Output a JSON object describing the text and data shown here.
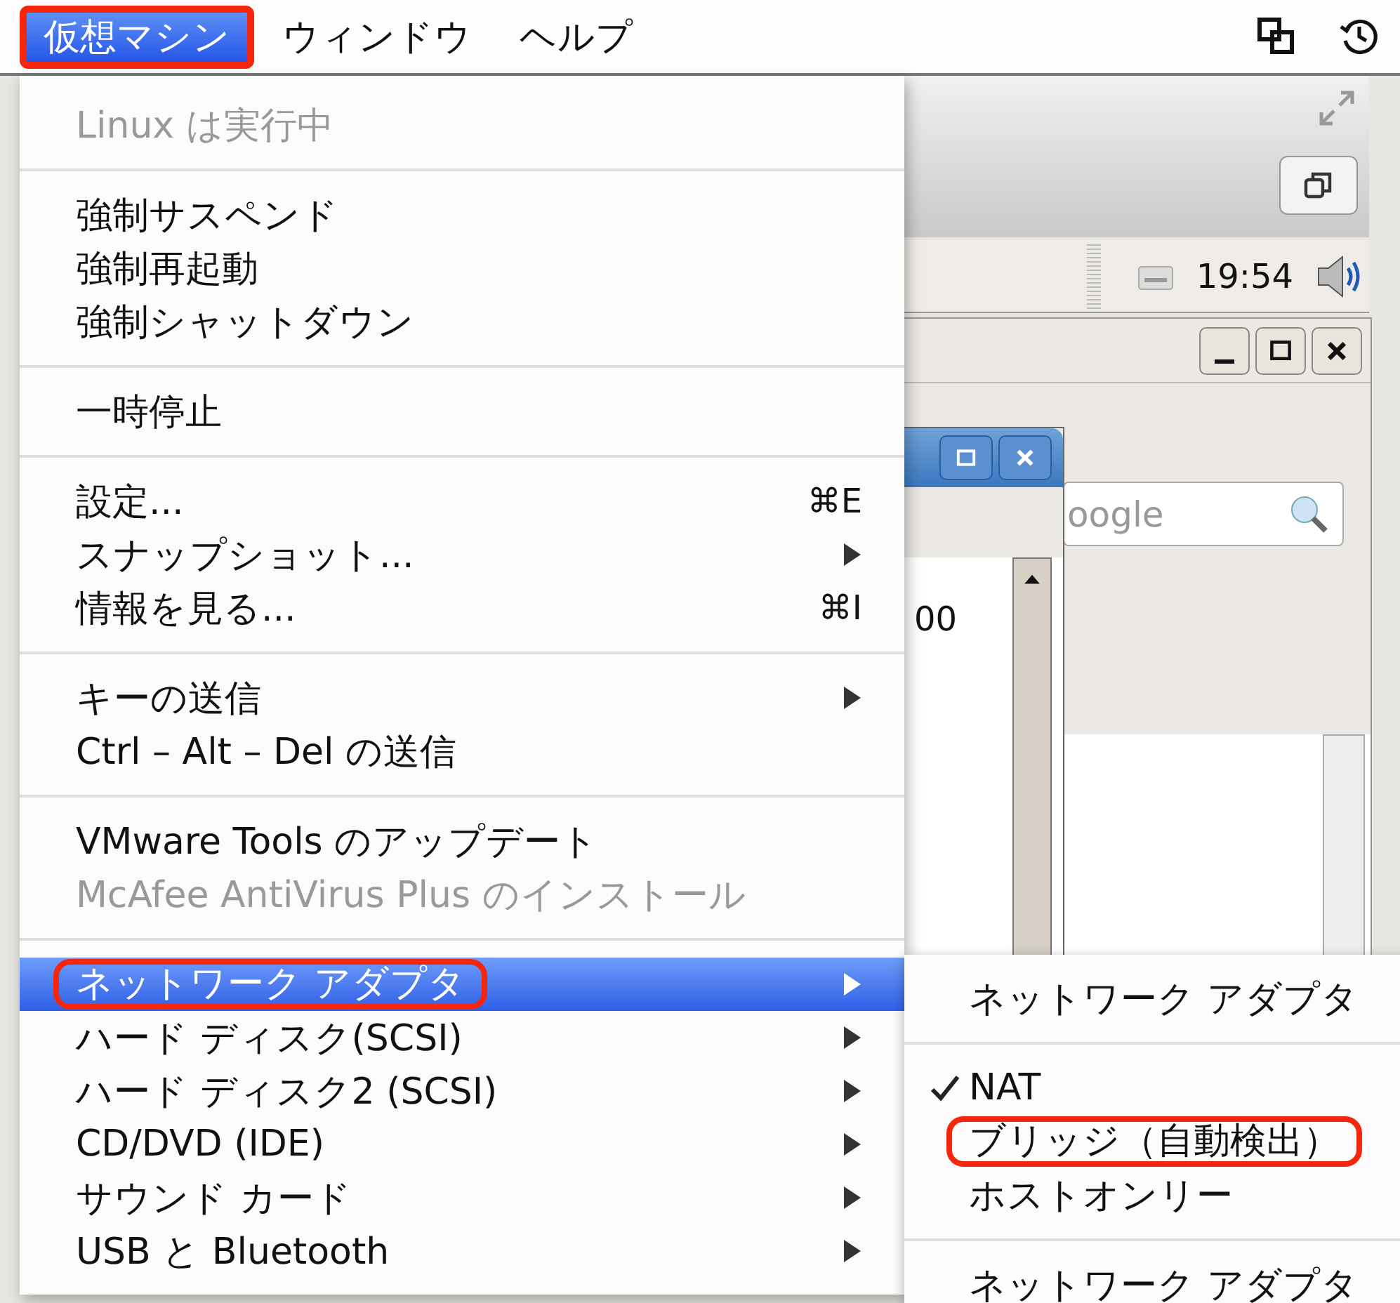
{
  "menubar": {
    "items": [
      {
        "label": "仮想マシン",
        "selected": true,
        "highlighted": true
      },
      {
        "label": "ウィンドウ",
        "selected": false,
        "highlighted": false
      },
      {
        "label": "ヘルプ",
        "selected": false,
        "highlighted": false
      }
    ]
  },
  "guest_screen": {
    "clock": "19:54",
    "search_placeholder": "oogle",
    "partial_text": "00"
  },
  "menu": {
    "sections": [
      [
        {
          "label": "Linux は実行中",
          "disabled": true,
          "selected": false,
          "highlighted": false,
          "submenu": false
        }
      ],
      [
        {
          "label": "強制サスペンド",
          "disabled": false,
          "selected": false,
          "highlighted": false,
          "submenu": false
        },
        {
          "label": "強制再起動",
          "disabled": false,
          "selected": false,
          "highlighted": false,
          "submenu": false
        },
        {
          "label": "強制シャットダウン",
          "disabled": false,
          "selected": false,
          "highlighted": false,
          "submenu": false
        }
      ],
      [
        {
          "label": "一時停止",
          "disabled": false,
          "selected": false,
          "highlighted": false,
          "submenu": false
        }
      ],
      [
        {
          "label": "設定...",
          "shortcut": "⌘E",
          "disabled": false,
          "selected": false,
          "highlighted": false,
          "submenu": false
        },
        {
          "label": "スナップショット...",
          "disabled": false,
          "selected": false,
          "highlighted": false,
          "submenu": true
        },
        {
          "label": "情報を見る...",
          "shortcut": "⌘I",
          "disabled": false,
          "selected": false,
          "highlighted": false,
          "submenu": false
        }
      ],
      [
        {
          "label": "キーの送信",
          "disabled": false,
          "selected": false,
          "highlighted": false,
          "submenu": true
        },
        {
          "label": "Ctrl – Alt – Del の送信",
          "disabled": false,
          "selected": false,
          "highlighted": false,
          "submenu": false
        }
      ],
      [
        {
          "label": "VMware Tools のアップデート",
          "disabled": false,
          "selected": false,
          "highlighted": false,
          "submenu": false
        },
        {
          "label": "McAfee AntiVirus Plus のインストール",
          "disabled": true,
          "selected": false,
          "highlighted": false,
          "submenu": false
        }
      ],
      [
        {
          "label": "ネットワーク アダプタ",
          "disabled": false,
          "selected": true,
          "highlighted": true,
          "submenu": true
        },
        {
          "label": "ハード ディスク(SCSI)",
          "disabled": false,
          "selected": false,
          "highlighted": false,
          "submenu": true
        },
        {
          "label": "ハード ディスク2 (SCSI)",
          "disabled": false,
          "selected": false,
          "highlighted": false,
          "submenu": true
        },
        {
          "label": "CD/DVD (IDE)",
          "disabled": false,
          "selected": false,
          "highlighted": false,
          "submenu": true
        },
        {
          "label": "サウンド カード",
          "disabled": false,
          "selected": false,
          "highlighted": false,
          "submenu": true
        },
        {
          "label": "USB と Bluetooth",
          "disabled": false,
          "selected": false,
          "highlighted": false,
          "submenu": true
        }
      ]
    ]
  },
  "submenu": {
    "sections": [
      [
        {
          "label": "ネットワーク アダプタ",
          "checked": false,
          "highlighted": false
        }
      ],
      [
        {
          "label": "NAT",
          "checked": true,
          "highlighted": false
        },
        {
          "label": "ブリッジ（自動検出）",
          "checked": false,
          "highlighted": true
        },
        {
          "label": "ホストオンリー",
          "checked": false,
          "highlighted": false
        }
      ],
      [
        {
          "label": "ネットワーク アダプタ",
          "checked": false,
          "highlighted": false
        }
      ]
    ]
  }
}
